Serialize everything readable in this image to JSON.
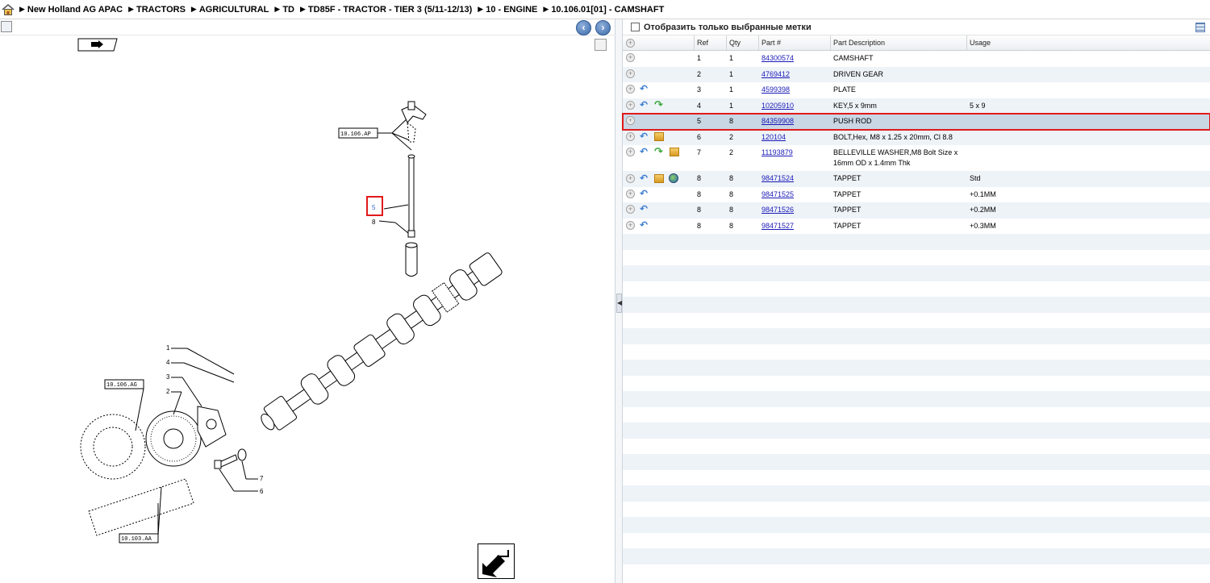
{
  "breadcrumb": {
    "items": [
      "New Holland AG APAC",
      "TRACTORS",
      "AGRICULTURAL",
      "TD",
      "TD85F - TRACTOR - TIER 3 (5/11-12/13)",
      "10 - ENGINE",
      "10.106.01[01] - CAMSHAFT"
    ]
  },
  "drawing": {
    "labels": {
      "ref_10106AP": "10.106.AP",
      "ref_10106AG": "10.106.AG",
      "ref_10103AA": "10.103.AA",
      "n1": "1",
      "n2": "2",
      "n3": "3",
      "n4": "4",
      "n5": "5",
      "n6": "6",
      "n7": "7",
      "n8": "8"
    }
  },
  "filter": {
    "label": "Отобразить только выбранные метки"
  },
  "table": {
    "headers": {
      "ref": "Ref",
      "qty": "Qty",
      "part": "Part #",
      "desc": "Part Description",
      "usage": "Usage"
    },
    "rows": [
      {
        "ref": "1",
        "qty": "1",
        "part": "84300574",
        "desc": "CAMSHAFT",
        "usage": "",
        "icons": []
      },
      {
        "ref": "2",
        "qty": "1",
        "part": "4769412",
        "desc": "DRIVEN GEAR",
        "usage": "",
        "icons": []
      },
      {
        "ref": "3",
        "qty": "1",
        "part": "4599398",
        "desc": "PLATE",
        "usage": "",
        "icons": [
          "undo"
        ]
      },
      {
        "ref": "4",
        "qty": "1",
        "part": "10205910",
        "desc": "KEY,5 x 9mm",
        "usage": "5 x 9",
        "icons": [
          "undo",
          "redo"
        ]
      },
      {
        "ref": "5",
        "qty": "8",
        "part": "84359908",
        "desc": "PUSH ROD",
        "usage": "",
        "icons": [],
        "selected": true
      },
      {
        "ref": "6",
        "qty": "2",
        "part": "120104",
        "desc": "BOLT,Hex, M8 x 1.25 x 20mm, Cl 8.8",
        "usage": "",
        "icons": [
          "undo",
          "box"
        ]
      },
      {
        "ref": "7",
        "qty": "2",
        "part": "11193879",
        "desc": "BELLEVILLE WASHER,M8 Bolt Size x 16mm OD x 1.4mm Thk",
        "usage": "",
        "icons": [
          "undo",
          "redo",
          "box"
        ]
      },
      {
        "ref": "8",
        "qty": "8",
        "part": "98471524",
        "desc": "TAPPET",
        "usage": "Std",
        "icons": [
          "undo",
          "box",
          "globe"
        ]
      },
      {
        "ref": "8",
        "qty": "8",
        "part": "98471525",
        "desc": "TAPPET",
        "usage": "+0.1MM",
        "icons": [
          "undo"
        ]
      },
      {
        "ref": "8",
        "qty": "8",
        "part": "98471526",
        "desc": "TAPPET",
        "usage": "+0.2MM",
        "icons": [
          "undo"
        ]
      },
      {
        "ref": "8",
        "qty": "8",
        "part": "98471527",
        "desc": "TAPPET",
        "usage": "+0.3MM",
        "icons": [
          "undo"
        ]
      }
    ]
  },
  "colors": {
    "selection_outline": "#e01a1a",
    "link": "#1a1ab8",
    "row_alt": "#eef3f8",
    "selected_row": "#c9d6e4"
  }
}
